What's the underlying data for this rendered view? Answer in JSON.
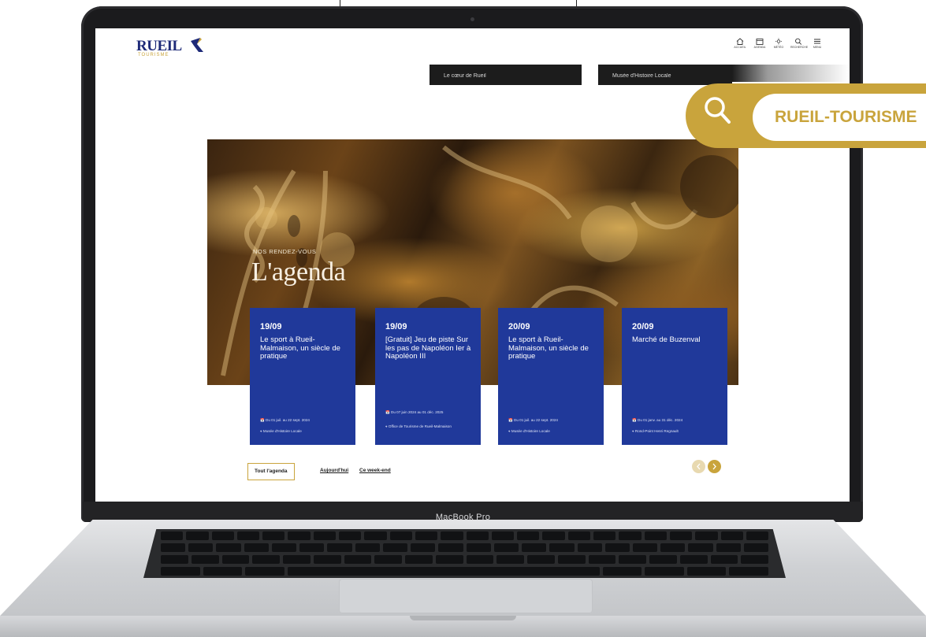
{
  "device": {
    "label": "MacBook Pro"
  },
  "header": {
    "logo_text": "RUEIL",
    "logo_sub": "TOURISME",
    "nav": [
      {
        "label": "ACCUEIL",
        "icon": "home-icon"
      },
      {
        "label": "AGENDA",
        "icon": "calendar-icon"
      },
      {
        "label": "MÉTÉO",
        "icon": "sun-icon"
      },
      {
        "label": "RECHERCHE",
        "icon": "search-icon"
      },
      {
        "label": "MENU",
        "icon": "menu-icon"
      }
    ]
  },
  "top_cards": [
    {
      "label": "Le cœur de Rueil"
    },
    {
      "label": "Musée d'Histoire Locale"
    }
  ],
  "hero": {
    "kicker": "NOS RENDEZ-VOUS",
    "title": "L'agenda"
  },
  "events": [
    {
      "date": "19/09",
      "title": "Le sport à Rueil-Malmaison, un siècle de pratique",
      "period": "Du 01 juil. au 22 sept. 2024",
      "place": "Musée d'Histoire Locale"
    },
    {
      "date": "19/09",
      "title": "[Gratuit] Jeu de piste Sur les pas de Napoléon Ier à Napoléon III",
      "period": "Du 07 juin 2024 au 01 déc. 2025",
      "place": "Office de Tourisme de Rueil-Malmaison"
    },
    {
      "date": "20/09",
      "title": "Le sport à Rueil-Malmaison, un siècle de pratique",
      "period": "Du 01 juil. au 22 sept. 2024",
      "place": "Musée d'Histoire Locale"
    },
    {
      "date": "20/09",
      "title": "Marché de Buzenval",
      "period": "Du 01 janv. au 31 déc. 2024",
      "place": "Rond-Point Henri Regnault"
    }
  ],
  "filters": {
    "all": "Tout l'agenda",
    "today": "Aujourd'hui",
    "weekend": "Ce week-end"
  },
  "search_overlay": {
    "text": "RUEIL-TOURISME"
  },
  "colors": {
    "navy": "#20399a",
    "gold": "#c9a43c"
  }
}
